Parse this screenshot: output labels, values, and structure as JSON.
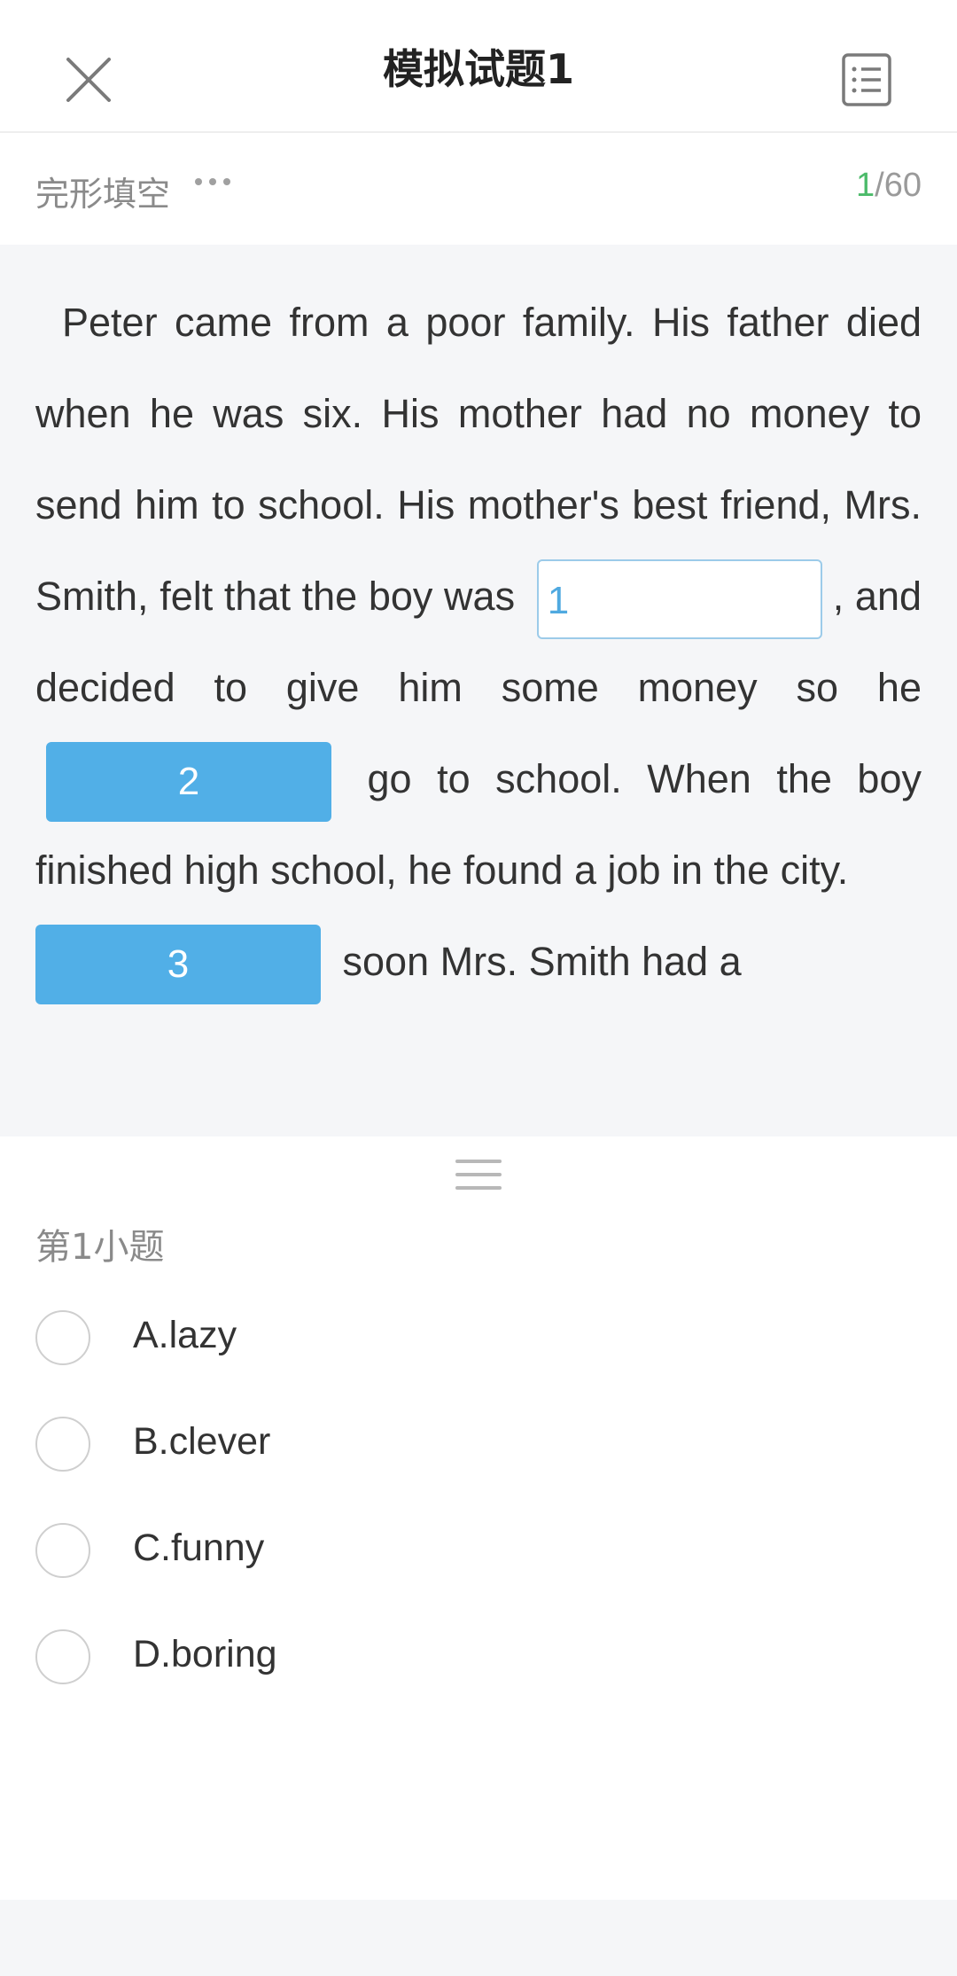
{
  "header": {
    "title": "模拟试题1",
    "close_icon": "close-icon",
    "list_icon": "list-icon"
  },
  "subbar": {
    "section": "完形填空",
    "more_icon": "more-dots-icon",
    "progress_current": "1",
    "progress_total": "/60"
  },
  "passage": {
    "segments": [
      "Peter came from a poor family. His father died when he was six. His mother had no money to send him to school. His mother's best friend, Mrs. Smith, felt that the boy was",
      ", and decided to give him some money so he",
      "go to school. When the boy finished high school, he found a job in the city.",
      "soon Mrs. Smith had a"
    ],
    "blanks": [
      {
        "number": "1",
        "state": "filled"
      },
      {
        "number": "2",
        "state": "active"
      },
      {
        "number": "3",
        "state": "active"
      }
    ]
  },
  "question": {
    "label": "第1小题",
    "options": [
      {
        "text": "A.lazy"
      },
      {
        "text": "B.clever"
      },
      {
        "text": "C.funny"
      },
      {
        "text": "D.boring"
      }
    ]
  },
  "colors": {
    "accent_blue": "#51afe7",
    "progress_green": "#4cbb6a",
    "passage_bg": "#f5f6f8"
  }
}
